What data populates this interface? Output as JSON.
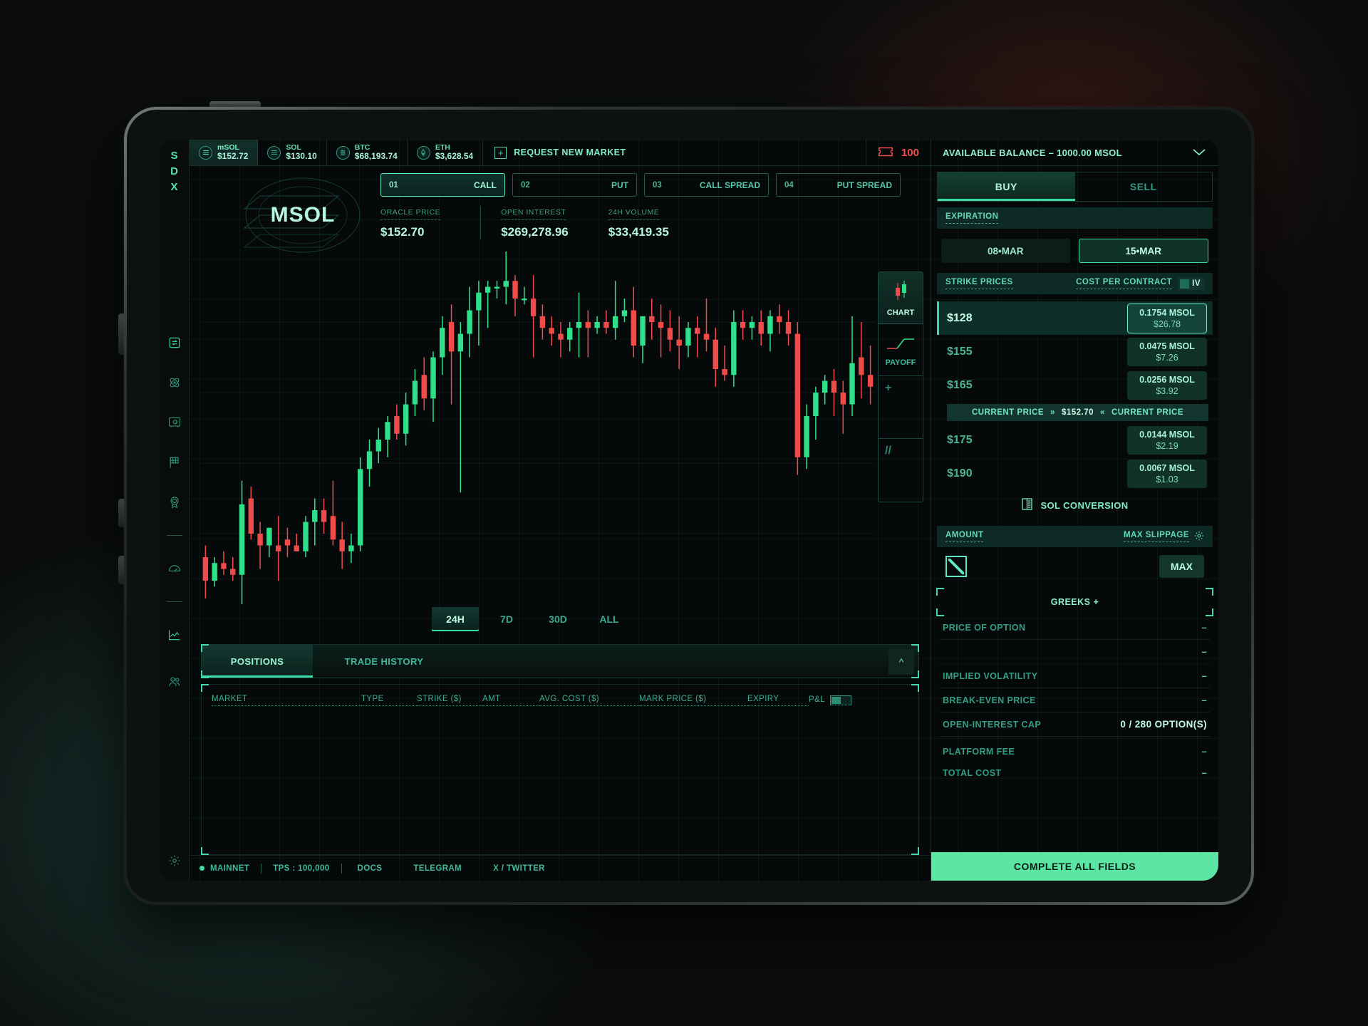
{
  "brand": {
    "logo_lines": [
      "S",
      "D",
      "X"
    ]
  },
  "topbar": {
    "tickers": [
      {
        "symbol": "mSOL",
        "price": "$152.72",
        "icon": "coin-icon",
        "active": true
      },
      {
        "symbol": "SOL",
        "price": "$130.10",
        "icon": "coin-icon",
        "active": false
      },
      {
        "symbol": "BTC",
        "price": "$68,193.74",
        "icon": "coin-icon",
        "active": false
      },
      {
        "symbol": "ETH",
        "price": "$3,628.54",
        "icon": "coin-icon",
        "active": false
      }
    ],
    "request_new_market": "REQUEST NEW MARKET",
    "ticket_count": "100"
  },
  "instrument": {
    "name": "MSOL",
    "types": [
      {
        "num": "01",
        "label": "CALL",
        "active": true
      },
      {
        "num": "02",
        "label": "PUT",
        "active": false
      },
      {
        "num": "03",
        "label": "CALL SPREAD",
        "active": false
      },
      {
        "num": "04",
        "label": "PUT SPREAD",
        "active": false
      }
    ],
    "stats": [
      {
        "label": "ORACLE PRICE",
        "value": "$152.70"
      },
      {
        "label": "OPEN INTEREST",
        "value": "$269,278.96"
      },
      {
        "label": "24H VOLUME",
        "value": "$33,419.35"
      }
    ]
  },
  "chart_panel": {
    "ranges": [
      {
        "label": "24H",
        "active": true
      },
      {
        "label": "7D",
        "active": false
      },
      {
        "label": "30D",
        "active": false
      },
      {
        "label": "ALL",
        "active": false
      }
    ],
    "side_buttons": [
      {
        "label": "CHART",
        "icon": "candlestick-icon",
        "active": true
      },
      {
        "label": "PAYOFF",
        "icon": "payoff-curve-icon",
        "active": false
      },
      {
        "label": "+",
        "icon": "plus-icon",
        "active": false
      },
      {
        "label": "//",
        "icon": "slash-icon",
        "active": false
      }
    ]
  },
  "chart_data": {
    "type": "candlestick",
    "title": "MSOL price",
    "timeframe": "24H",
    "up_color": "#2fe08a",
    "down_color": "#f04a4a",
    "xlabel": "",
    "ylabel": "",
    "grid": true,
    "ylim": [
      118,
      178
    ],
    "candles": [
      {
        "o": 126,
        "h": 128,
        "l": 119,
        "c": 122
      },
      {
        "o": 122,
        "h": 126,
        "l": 121,
        "c": 125
      },
      {
        "o": 125,
        "h": 127,
        "l": 123,
        "c": 124
      },
      {
        "o": 124,
        "h": 126,
        "l": 122,
        "c": 123
      },
      {
        "o": 123,
        "h": 139,
        "l": 118,
        "c": 135
      },
      {
        "o": 136,
        "h": 138,
        "l": 129,
        "c": 130
      },
      {
        "o": 130,
        "h": 132,
        "l": 124,
        "c": 128
      },
      {
        "o": 128,
        "h": 131,
        "l": 126,
        "c": 131
      },
      {
        "o": 128,
        "h": 133,
        "l": 122,
        "c": 127
      },
      {
        "o": 129,
        "h": 131,
        "l": 126,
        "c": 128
      },
      {
        "o": 128,
        "h": 130,
        "l": 127,
        "c": 127
      },
      {
        "o": 127,
        "h": 133,
        "l": 126,
        "c": 132
      },
      {
        "o": 132,
        "h": 136,
        "l": 128,
        "c": 134
      },
      {
        "o": 134,
        "h": 136,
        "l": 130,
        "c": 132
      },
      {
        "o": 133,
        "h": 139,
        "l": 128,
        "c": 129
      },
      {
        "o": 129,
        "h": 132,
        "l": 124,
        "c": 127
      },
      {
        "o": 127,
        "h": 130,
        "l": 125,
        "c": 128
      },
      {
        "o": 128,
        "h": 143,
        "l": 127,
        "c": 141
      },
      {
        "o": 141,
        "h": 146,
        "l": 138,
        "c": 144
      },
      {
        "o": 144,
        "h": 148,
        "l": 142,
        "c": 146
      },
      {
        "o": 146,
        "h": 150,
        "l": 143,
        "c": 149
      },
      {
        "o": 150,
        "h": 152,
        "l": 146,
        "c": 147
      },
      {
        "o": 147,
        "h": 154,
        "l": 145,
        "c": 152
      },
      {
        "o": 152,
        "h": 158,
        "l": 150,
        "c": 156
      },
      {
        "o": 157,
        "h": 160,
        "l": 151,
        "c": 153
      },
      {
        "o": 153,
        "h": 161,
        "l": 149,
        "c": 160
      },
      {
        "o": 160,
        "h": 167,
        "l": 157,
        "c": 165
      },
      {
        "o": 166,
        "h": 169,
        "l": 152,
        "c": 161
      },
      {
        "o": 161,
        "h": 166,
        "l": 137,
        "c": 164
      },
      {
        "o": 164,
        "h": 172,
        "l": 160,
        "c": 168
      },
      {
        "o": 168,
        "h": 173,
        "l": 162,
        "c": 171
      },
      {
        "o": 171,
        "h": 173,
        "l": 165,
        "c": 172
      },
      {
        "o": 172,
        "h": 173,
        "l": 170,
        "c": 172
      },
      {
        "o": 172,
        "h": 178,
        "l": 169,
        "c": 173
      },
      {
        "o": 173,
        "h": 174,
        "l": 167,
        "c": 170
      },
      {
        "o": 170,
        "h": 172,
        "l": 169,
        "c": 170
      },
      {
        "o": 170,
        "h": 174,
        "l": 160,
        "c": 167
      },
      {
        "o": 167,
        "h": 169,
        "l": 163,
        "c": 165
      },
      {
        "o": 165,
        "h": 167,
        "l": 162,
        "c": 164
      },
      {
        "o": 164,
        "h": 166,
        "l": 160,
        "c": 163
      },
      {
        "o": 163,
        "h": 166,
        "l": 161,
        "c": 165
      },
      {
        "o": 165,
        "h": 171,
        "l": 160,
        "c": 166
      },
      {
        "o": 166,
        "h": 168,
        "l": 160,
        "c": 165
      },
      {
        "o": 165,
        "h": 167,
        "l": 164,
        "c": 166
      },
      {
        "o": 166,
        "h": 168,
        "l": 164,
        "c": 165
      },
      {
        "o": 165,
        "h": 173,
        "l": 163,
        "c": 167
      },
      {
        "o": 167,
        "h": 170,
        "l": 166,
        "c": 168
      },
      {
        "o": 168,
        "h": 172,
        "l": 160,
        "c": 162
      },
      {
        "o": 162,
        "h": 165,
        "l": 159,
        "c": 167
      },
      {
        "o": 167,
        "h": 170,
        "l": 163,
        "c": 166
      },
      {
        "o": 166,
        "h": 169,
        "l": 160,
        "c": 165
      },
      {
        "o": 165,
        "h": 168,
        "l": 161,
        "c": 163
      },
      {
        "o": 163,
        "h": 167,
        "l": 158,
        "c": 162
      },
      {
        "o": 162,
        "h": 166,
        "l": 160,
        "c": 165
      },
      {
        "o": 165,
        "h": 167,
        "l": 160,
        "c": 164
      },
      {
        "o": 164,
        "h": 170,
        "l": 161,
        "c": 163
      },
      {
        "o": 163,
        "h": 165,
        "l": 155,
        "c": 158
      },
      {
        "o": 158,
        "h": 162,
        "l": 156,
        "c": 157
      },
      {
        "o": 157,
        "h": 168,
        "l": 155,
        "c": 166
      },
      {
        "o": 166,
        "h": 168,
        "l": 163,
        "c": 165
      },
      {
        "o": 165,
        "h": 167,
        "l": 163,
        "c": 166
      },
      {
        "o": 166,
        "h": 168,
        "l": 162,
        "c": 164
      },
      {
        "o": 164,
        "h": 168,
        "l": 161,
        "c": 167
      },
      {
        "o": 167,
        "h": 169,
        "l": 164,
        "c": 166
      },
      {
        "o": 166,
        "h": 168,
        "l": 162,
        "c": 164
      },
      {
        "o": 164,
        "h": 166,
        "l": 140,
        "c": 143
      },
      {
        "o": 143,
        "h": 152,
        "l": 141,
        "c": 150
      },
      {
        "o": 150,
        "h": 155,
        "l": 146,
        "c": 154
      },
      {
        "o": 154,
        "h": 157,
        "l": 152,
        "c": 156
      },
      {
        "o": 156,
        "h": 158,
        "l": 150,
        "c": 154
      },
      {
        "o": 154,
        "h": 156,
        "l": 147,
        "c": 152
      },
      {
        "o": 152,
        "h": 167,
        "l": 150,
        "c": 159
      },
      {
        "o": 160,
        "h": 166,
        "l": 153,
        "c": 157
      },
      {
        "o": 157,
        "h": 162,
        "l": 152,
        "c": 155
      }
    ]
  },
  "positions": {
    "tabs": [
      {
        "label": "POSITIONS",
        "active": true
      },
      {
        "label": "TRADE HISTORY",
        "active": false
      }
    ],
    "collapse_icon": "chevron-up-icon",
    "columns": [
      "MARKET",
      "TYPE",
      "STRIKE ($)",
      "AMT",
      "AVG. COST ($)",
      "MARK PRICE ($)",
      "EXPIRY",
      "P&L"
    ],
    "rows": []
  },
  "status": {
    "network": "MAINNET",
    "tps": "TPS : 100,000",
    "links": [
      "DOCS",
      "TELEGRAM",
      "X / TWITTER"
    ]
  },
  "side": {
    "balance": "AVAILABLE BALANCE – 1000.00 MSOL",
    "balance_caret": "chevron-down-icon",
    "side_tabs": [
      {
        "label": "BUY",
        "active": true
      },
      {
        "label": "SELL",
        "active": false
      }
    ],
    "expiration_label": "EXPIRATION",
    "expirations": [
      {
        "label": "08•MAR",
        "active": false
      },
      {
        "label": "15•MAR",
        "active": true
      }
    ],
    "strike_header": {
      "left": "STRIKE PRICES",
      "right": "COST PER CONTRACT",
      "iv": "IV"
    },
    "strikes": [
      {
        "strike": "$128",
        "cost_msol": "0.1754 MSOL",
        "cost_usd": "$26.78",
        "selected": true
      },
      {
        "strike": "$155",
        "cost_msol": "0.0475 MSOL",
        "cost_usd": "$7.26",
        "selected": false
      },
      {
        "strike": "$165",
        "cost_msol": "0.0256 MSOL",
        "cost_usd": "$3.92",
        "selected": false
      }
    ],
    "current_price_marker": {
      "left": "CURRENT PRICE",
      "value": "$152.70",
      "right": "CURRENT PRICE"
    },
    "strikes_below": [
      {
        "strike": "$175",
        "cost_msol": "0.0144 MSOL",
        "cost_usd": "$2.19",
        "selected": false
      },
      {
        "strike": "$190",
        "cost_msol": "0.0067 MSOL",
        "cost_usd": "$1.03",
        "selected": false
      }
    ],
    "sol_conversion": "SOL CONVERSION",
    "amount_header": {
      "left": "AMOUNT",
      "right": "MAX SLIPPAGE",
      "gear": "gear-icon"
    },
    "amount_value": "",
    "amount_placeholder": "",
    "max_button": "MAX",
    "greeks_label": "GREEKS +",
    "detail_rows": [
      {
        "label": "PRICE OF OPTION",
        "value": "–"
      },
      {
        "label": "",
        "value": "–"
      },
      {
        "label": "IMPLIED VOLATILITY",
        "value": "–"
      },
      {
        "label": "BREAK-EVEN PRICE",
        "value": "–"
      },
      {
        "label": "OPEN-INTEREST CAP",
        "value": "0 / 280 OPTION(S)"
      },
      {
        "label": "PLATFORM FEE",
        "value": "–"
      },
      {
        "label": "TOTAL COST",
        "value": "–"
      }
    ],
    "cta": "COMPLETE ALL FIELDS"
  },
  "colors": {
    "accent": "#3ddba8",
    "accent_bright": "#5ce6a4",
    "up": "#2fe08a",
    "down": "#f04a4a",
    "warn": "#ef4e4e"
  }
}
